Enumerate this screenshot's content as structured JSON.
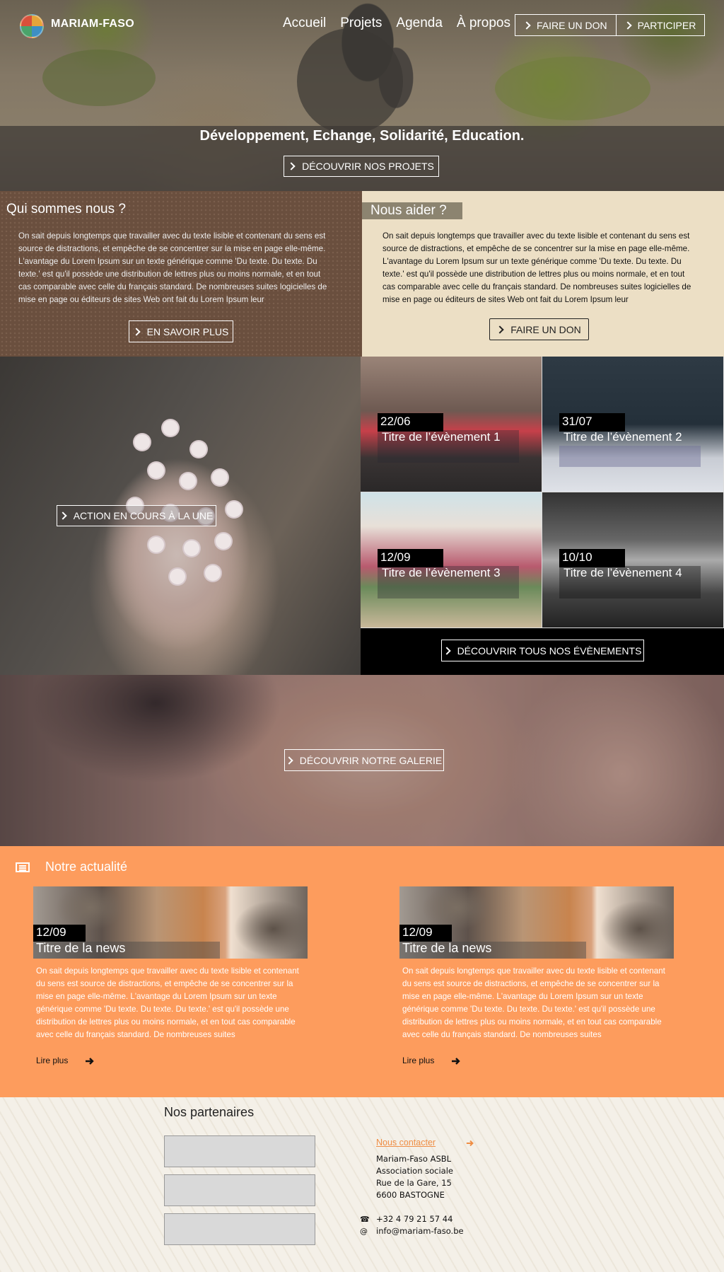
{
  "header": {
    "brand": "MARIAM-FASO",
    "menu": [
      "Accueil",
      "Projets",
      "Agenda",
      "À propos"
    ],
    "donate_label": "FAIRE UN DON",
    "participate_label": "PARTICIPER",
    "tagline": "Développement, Echange, Solidarité, Education.",
    "discover_projects_label": "DÉCOUVRIR NOS PROJETS"
  },
  "who": {
    "title": "Qui sommes nous ?",
    "text": "On sait depuis longtemps que travailler avec du texte lisible et contenant du sens est source de distractions, et empêche de se concentrer sur la mise en page elle-même. L'avantage du Lorem Ipsum sur un texte générique comme 'Du texte. Du texte. Du texte.' est qu'il possède une distribution de lettres plus ou moins normale, et en tout cas comparable avec celle du français standard. De nombreuses suites logicielles de mise en page ou éditeurs de sites Web ont fait du Lorem Ipsum leur",
    "button": "EN SAVOIR PLUS"
  },
  "help": {
    "title": "Nous aider ?",
    "text": "On sait depuis longtemps que travailler avec du texte lisible et contenant du sens est source de distractions, et empêche de se concentrer sur la mise en page elle-même. L'avantage du Lorem Ipsum sur un texte générique comme 'Du texte. Du texte. Du texte.' est qu'il possède une distribution de lettres plus ou moins normale, et en tout cas comparable avec celle du français standard. De nombreuses suites logicielles de mise en page ou éditeurs de sites Web ont fait du Lorem Ipsum leur",
    "button": "FAIRE UN DON"
  },
  "feature": {
    "button": "ACTION EN COURS À LA UNE"
  },
  "events": {
    "items": [
      {
        "date": "22/06",
        "title": "Titre de l’évènement 1"
      },
      {
        "date": "31/07",
        "title": "Titre de l’évènement 2"
      },
      {
        "date": "12/09",
        "title": "Titre de l’évènement 3"
      },
      {
        "date": "10/10",
        "title": "Titre de l’évènement 4"
      }
    ],
    "button": "DÉCOUVRIR TOUS NOS ÉVÈNEMENTS"
  },
  "gallery": {
    "button": "DÉCOUVRIR NOTRE GALERIE"
  },
  "news": {
    "title": "Notre actualité",
    "items": [
      {
        "date": "12/09",
        "title": "Titre de la news",
        "text": "On sait depuis longtemps que travailler avec du texte lisible et contenant du sens est source de distractions, et empêche de se concentrer sur la mise en page elle-même. L'avantage du Lorem Ipsum sur un texte générique comme 'Du texte. Du texte. Du texte.' est qu'il possède une distribution de lettres plus ou moins normale, et en tout cas comparable avec celle du français standard. De nombreuses suites",
        "read_more": "Lire plus"
      },
      {
        "date": "12/09",
        "title": "Titre de la news",
        "text": "On sait depuis longtemps que travailler avec du texte lisible et contenant du sens est source de distractions, et empêche de se concentrer sur la mise en page elle-même. L'avantage du Lorem Ipsum sur un texte générique comme 'Du texte. Du texte. Du texte.' est qu'il possède une distribution de lettres plus ou moins normale, et en tout cas comparable avec celle du français standard. De nombreuses suites",
        "read_more": "Lire plus"
      }
    ]
  },
  "footer": {
    "partners_title": "Nos partenaires",
    "contact_link": "Nous contacter",
    "address": [
      "Mariam-Faso ASBL",
      "Association sociale",
      "Rue de la Gare, 15",
      "6600 BASTOGNE"
    ],
    "phone": "+32 4 79 21 57 44",
    "email": "info@mariam-faso.be",
    "phone_icon_glyph": "☎",
    "email_icon_glyph": "@"
  },
  "colors": {
    "accent_orange": "#fd9c5d",
    "brown": "#6a4f3e",
    "beige": "#ecdfc5",
    "link_orange": "#ef8e45"
  }
}
